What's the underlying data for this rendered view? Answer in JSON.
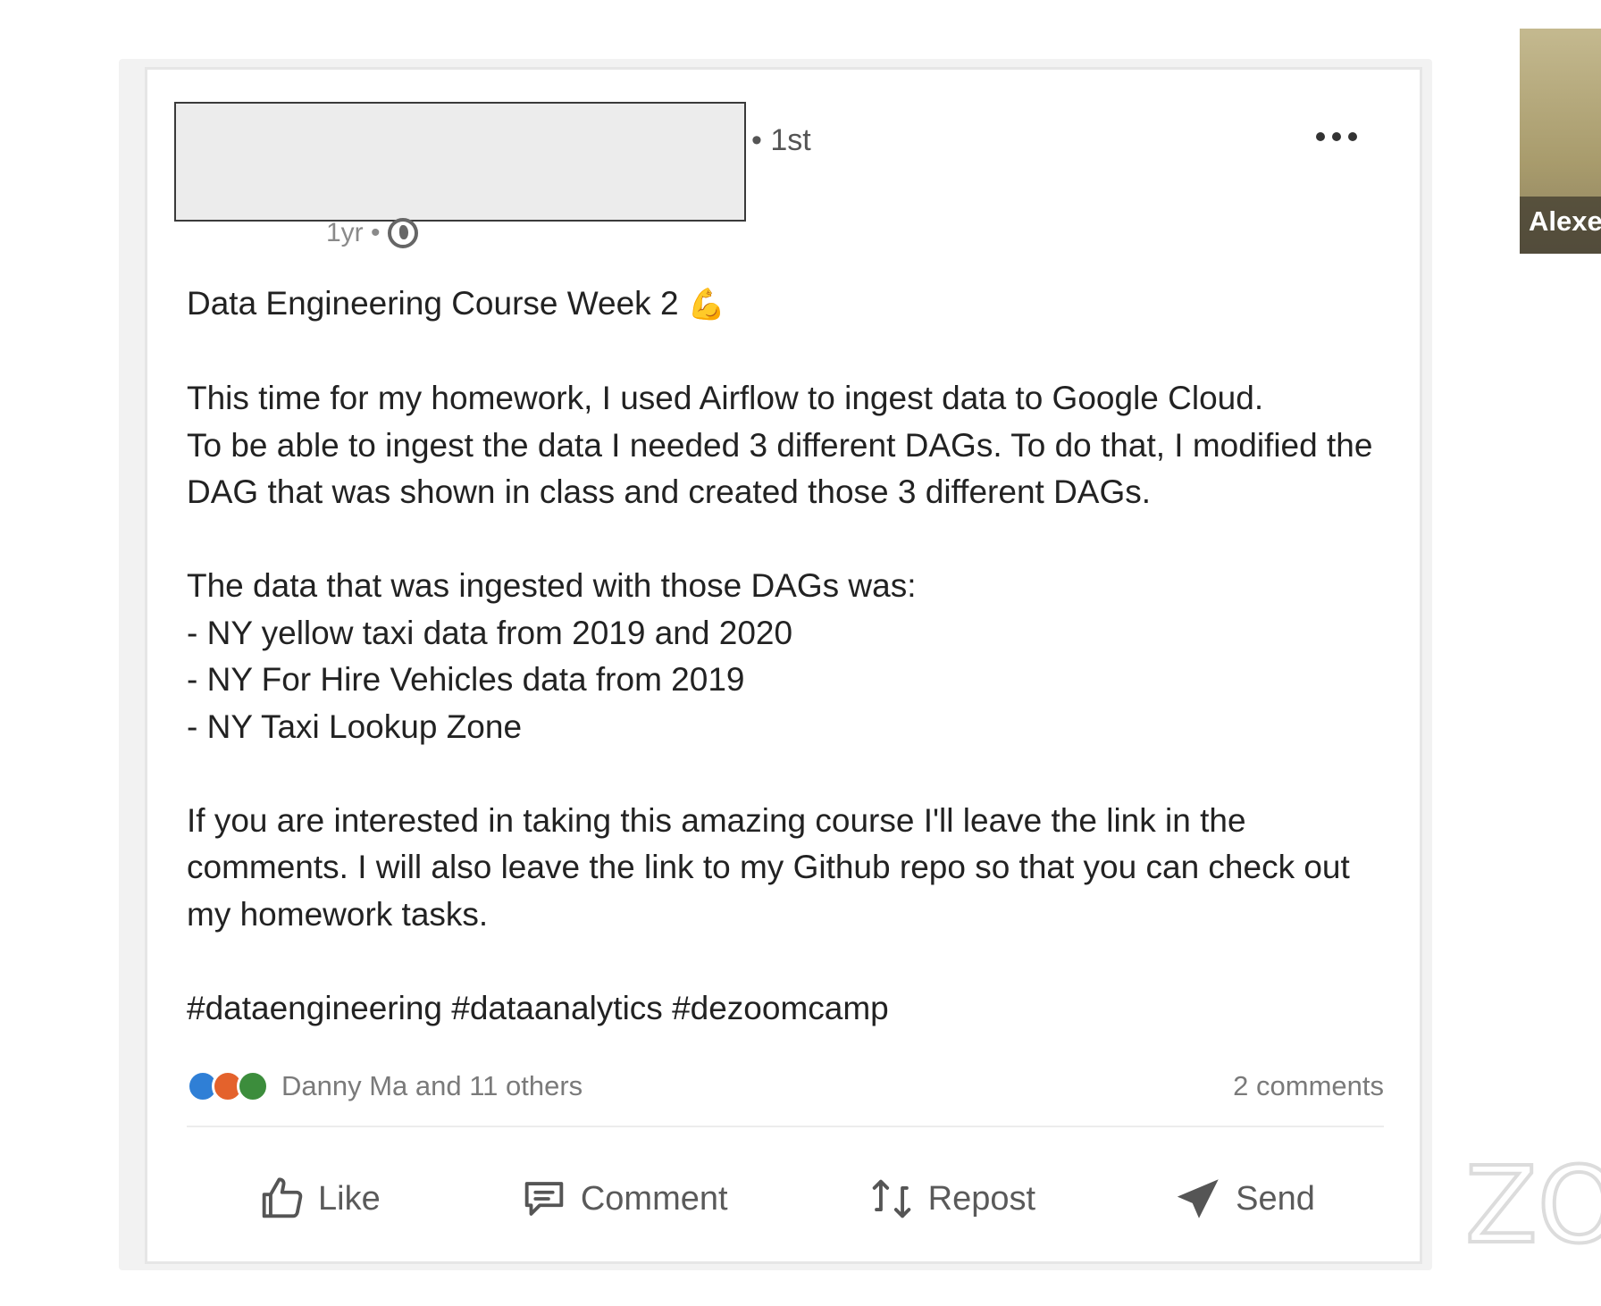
{
  "post": {
    "connection_degree": "• 1st",
    "time_ago": "1yr •",
    "title": "Data Engineering Course Week 2",
    "paragraphs": [
      "This time for my homework, I used Airflow to ingest data to Google Cloud.\nTo be able to ingest the data I needed 3 different DAGs. To do that, I modified the\nDAG that was shown in class and created those 3 different DAGs.",
      "The data that was ingested with those DAGs was:\n - NY yellow taxi data from 2019 and 2020\n - NY For Hire Vehicles data from 2019\n - NY Taxi Lookup Zone",
      "If you are interested in taking this amazing course I'll leave the link in the\ncomments. I will also leave the link to my Github repo so that you can check out\nmy homework tasks.",
      "#dataengineering #dataanalytics #dezoomcamp"
    ],
    "reactions_label": "Danny Ma and 11 others",
    "comments_label": "2 comments"
  },
  "actions": {
    "like": "Like",
    "comment": "Comment",
    "repost": "Repost",
    "send": "Send"
  },
  "video_participant": {
    "name": "Alexe"
  },
  "icons": {
    "more": "more-dots-icon",
    "visibility": "globe-icon",
    "title_emoji": "flexed-biceps-icon",
    "like": "thumbs-up-icon",
    "comment": "comment-bubble-icon",
    "repost": "repost-icon",
    "send": "send-icon",
    "logo": "zoom-logo"
  },
  "colors": {
    "like_reaction": "#2f7fd6",
    "love_reaction": "#e4622c",
    "insightful_reaction": "#3c8d3c"
  }
}
